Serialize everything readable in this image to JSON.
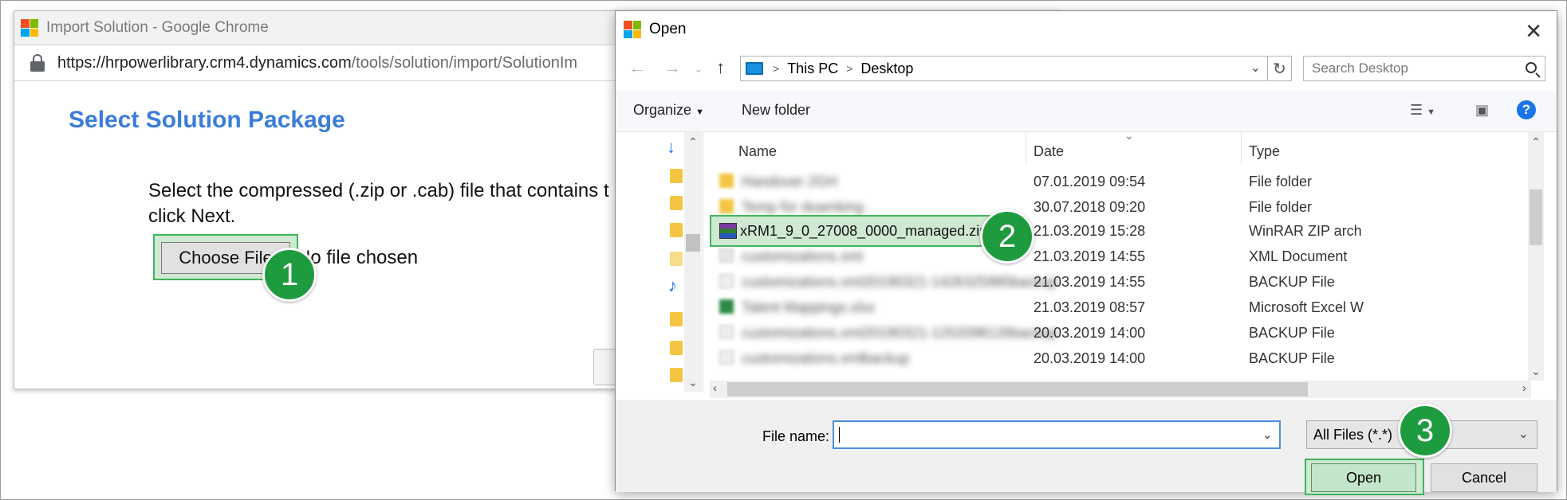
{
  "browser": {
    "title": "Import Solution - Google Chrome",
    "url_host": "https://hrpowerlibrary.crm4.dynamics.com",
    "url_path": "/tools/solution/import/SolutionIm"
  },
  "page": {
    "heading": "Select Solution Package",
    "instruction": "Select the compressed (.zip or .cab) file that contains t and click Next.",
    "choose_file_label": "Choose File",
    "no_file_text": "No file chosen"
  },
  "callouts": [
    "1",
    "2",
    "3"
  ],
  "dialog": {
    "title": "Open",
    "close": "✕",
    "breadcrumb": [
      "This PC",
      "Desktop"
    ],
    "search_placeholder": "Search Desktop",
    "toolbar": {
      "organize": "Organize",
      "new_folder": "New folder",
      "help": "?"
    },
    "columns": {
      "name": "Name",
      "date": "Date",
      "type": "Type"
    },
    "rows": [
      {
        "name": "Handover 2GH",
        "date": "07.01.2019 09:54",
        "type": "File folder"
      },
      {
        "name": "Temp für doamking",
        "date": "30.07.2018 09:20",
        "type": "File folder"
      },
      {
        "name": "xRM1_9_0_27008_0000_managed.zip",
        "date": "21.03.2019 15:28",
        "type": "WinRAR ZIP arch"
      },
      {
        "name": "customizations.xml",
        "date": "21.03.2019 14:55",
        "type": "XML Document"
      },
      {
        "name": "customizations.xml20190321-1426325985backup",
        "date": "21.03.2019 14:55",
        "type": "BACKUP File"
      },
      {
        "name": "Talent Mappings.xlsx",
        "date": "21.03.2019 08:57",
        "type": "Microsoft Excel W"
      },
      {
        "name": "customizations.xml20190321-1252098126backup",
        "date": "20.03.2019 14:00",
        "type": "BACKUP File"
      },
      {
        "name": "customizations.xmlbackup",
        "date": "20.03.2019 14:00",
        "type": "BACKUP File"
      }
    ],
    "file_name_label": "File name:",
    "file_name_value": "",
    "file_type": "All Files (*.*)",
    "open_label": "Open",
    "cancel_label": "Cancel"
  },
  "colors": {
    "accent_green": "#1d9b3e",
    "heading_blue": "#3b7dd8",
    "highlight_green": "#cfe9d3"
  }
}
